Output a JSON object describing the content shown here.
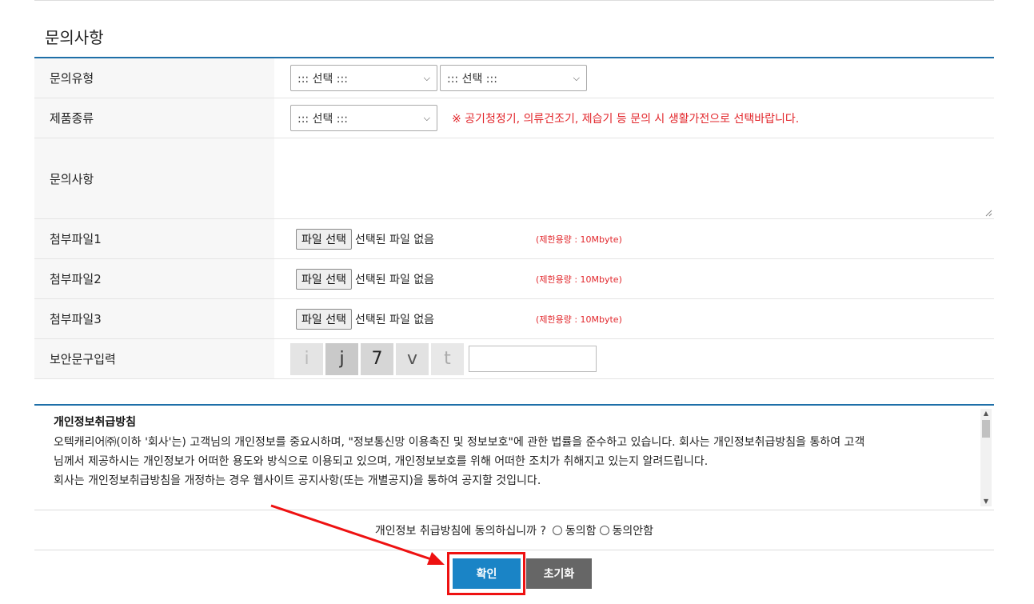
{
  "section_title": "문의사항",
  "rows": {
    "inquiry_type_label": "문의유형",
    "inquiry_type_select1": "::: 선택 :::",
    "inquiry_type_select2": "::: 선택 :::",
    "product_type_label": "제품종류",
    "product_type_select": "::: 선택 :::",
    "product_notice": "※ 공기청정기, 의류건조기, 제습기 등 문의 시 생활가전으로 선택바랍니다.",
    "inquiry_content_label": "문의사항",
    "attach1_label": "첨부파일1",
    "attach2_label": "첨부파일2",
    "attach3_label": "첨부파일3",
    "file_button": "파일 선택",
    "file_status": "선택된 파일 없음",
    "file_limit": "(제한용량 : 10Mbyte)",
    "captcha_label": "보안문구입력",
    "captcha_chars": [
      "i",
      "j",
      "7",
      "v",
      "t"
    ]
  },
  "policy": {
    "title": "개인정보취급방침",
    "lines": [
      "오텍캐리어㈜(이하 '회사'는) 고객님의 개인정보를 중요시하며, \"정보통신망 이용촉진 및 정보보호\"에 관한 법률을 준수하고 있습니다. 회사는 개인정보취급방침을 통하여 고객",
      "님께서 제공하시는 개인정보가 어떠한 용도와 방식으로 이용되고 있으며, 개인정보보호를 위해 어떠한 조치가 취해지고 있는지 알려드립니다.",
      "회사는 개인정보취급방침을 개정하는 경우 웹사이트 공지사항(또는 개별공지)을 통하여 공지할 것입니다."
    ]
  },
  "agree": {
    "question": "개인정보 취급방침에 동의하십니까 ?",
    "agree_label": "동의함",
    "disagree_label": "동의안함"
  },
  "buttons": {
    "confirm": "확인",
    "reset": "초기화"
  },
  "colors": {
    "accent": "#1e6fa8",
    "confirm_bg": "#1a84c6",
    "reset_bg": "#666666",
    "notice": "#e2262b",
    "highlight": "#ee1111"
  }
}
